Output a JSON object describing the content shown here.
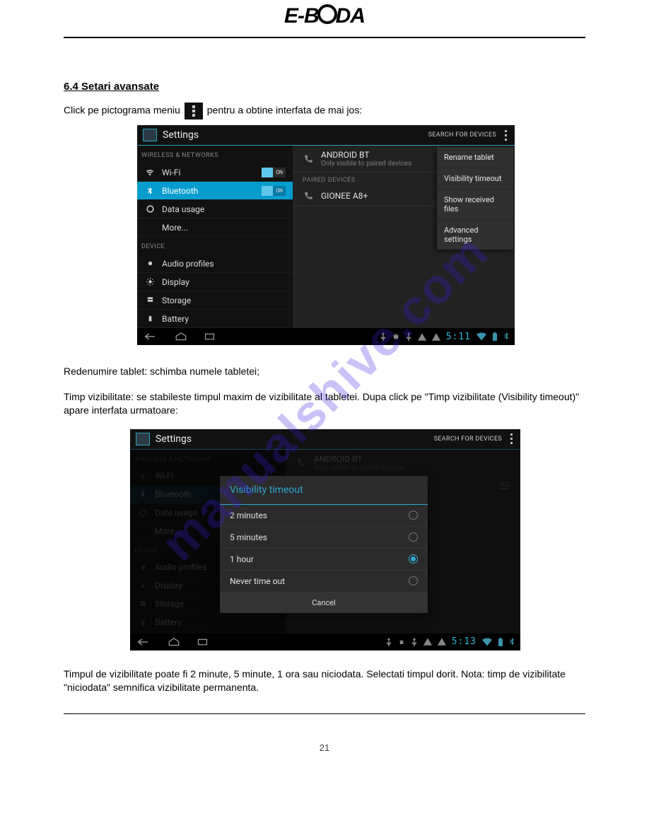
{
  "logo_text": "E-BODA",
  "watermark": "manualshive.com",
  "page_number": "21",
  "section": {
    "title": "6.4 Setari avansate",
    "intro_pre": "Click pe pictograma meniu",
    "intro_post": "pentru a obtine interfata de mai jos:"
  },
  "screenshot1": {
    "title": "Settings",
    "search": "SEARCH FOR DEVICES",
    "cat_wireless": "WIRELESS & NETWORKS",
    "cat_device": "DEVICE",
    "rows": {
      "wifi": "Wi-Fi",
      "bt": "Bluetooth",
      "data": "Data usage",
      "more": "More...",
      "audio": "Audio profiles",
      "display": "Display",
      "storage": "Storage",
      "battery": "Battery"
    },
    "toggle_on": "ON",
    "bt_name": "ANDROID BT",
    "bt_sub": "Only visible to paired devices",
    "paired_hdr": "PAIRED DEVICES",
    "paired1": "GIONEE A8+",
    "popup": {
      "rename": "Rename tablet",
      "timeout": "Visibility timeout",
      "received": "Show received files",
      "advanced": "Advanced settings"
    },
    "clock": "5:11"
  },
  "mid_text": {
    "rename_line": "Redenumire tablet: schimba numele tabletei;",
    "timeout_intro": "Timp vizibilitate: se stabileste timpul maxim de vizibilitate al tabletei. Dupa click pe \"Timp vizibilitate (Visibility timeout)\" apare interfata urmatoare:"
  },
  "screenshot2": {
    "title": "Settings",
    "search": "SEARCH FOR DEVICES",
    "cat_wireless": "WIRELESS & NETWORKS",
    "cat_device": "DEVICE",
    "rows": {
      "wifi": "Wi-Fi",
      "bt": "Bluetooth",
      "data": "Data usage",
      "more": "More...",
      "audio": "Audio profiles",
      "display": "Display",
      "storage": "Storage",
      "battery": "Battery"
    },
    "bt_name": "ANDROID BT",
    "bt_sub": "Only visible to paired devices",
    "dialog": {
      "title": "Visibility timeout",
      "o1": "2 minutes",
      "o2": "5 minutes",
      "o3": "1 hour",
      "o4": "Never time out",
      "cancel": "Cancel"
    },
    "clock": "5:13"
  },
  "after_text": "Timpul de vizibilitate poate fi 2 minute, 5 minute, 1 ora sau niciodata. Selectati timpul dorit. Nota: timp de vizibilitate \"niciodata\" semnifica vizibilitate permanenta."
}
